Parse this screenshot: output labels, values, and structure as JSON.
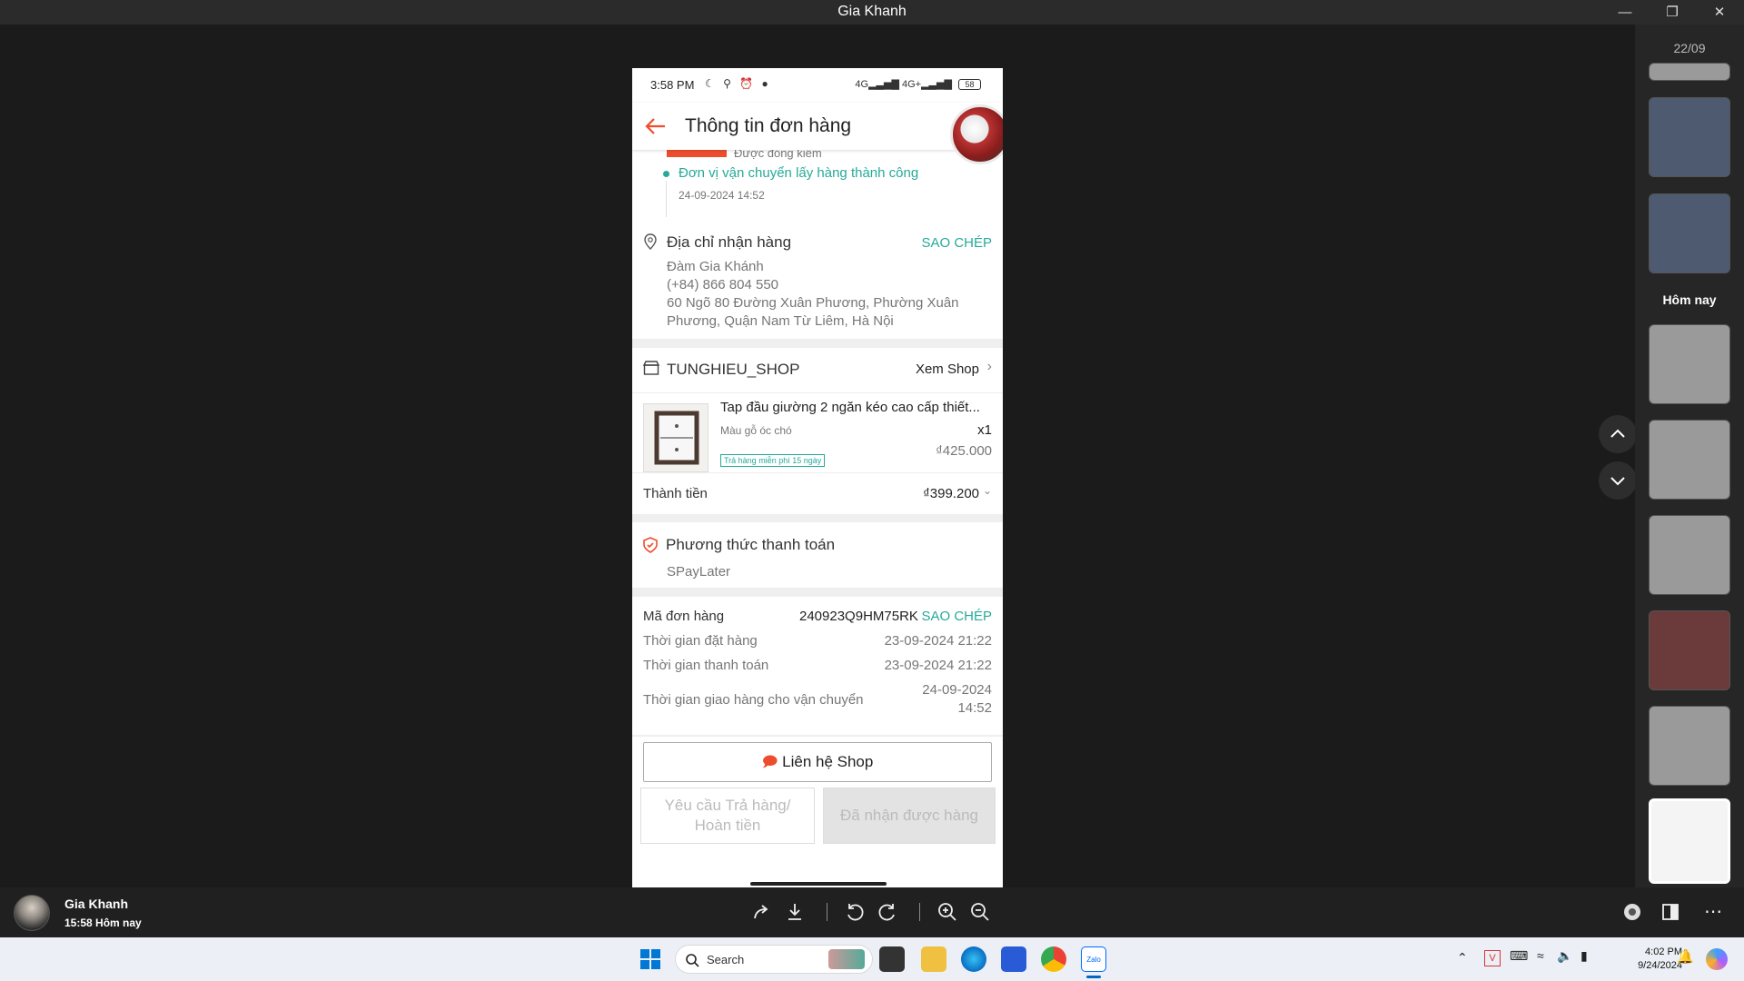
{
  "window": {
    "title": "Gia Khanh"
  },
  "phone": {
    "status": {
      "time": "3:58 PM",
      "network": "4G",
      "network2": "4G+",
      "battery": "58"
    },
    "appbar": {
      "title": "Thông tin đơn hàng"
    },
    "tracking": {
      "partial_text": "Được đóng kiểm",
      "event": "Đơn vị vận chuyển lấy hàng thành công",
      "event_time": "24-09-2024 14:52"
    },
    "address": {
      "heading": "Địa chỉ nhận hàng",
      "copy": "SAO CHÉP",
      "name": "Đàm Gia Khánh",
      "phone": "(+84) 866 804 550",
      "line1": "60 Ngõ 80 Đường Xuân Phương, Phường Xuân",
      "line2": "Phương, Quận Nam Từ Liêm, Hà Nội"
    },
    "shop": {
      "name": "TUNGHIEU_SHOP",
      "view": "Xem Shop",
      "product_title": "Tap đầu giường 2 ngăn kéo cao cấp thiết...",
      "variant": "Màu gỗ óc chó",
      "qty": "x1",
      "tag": "Trả hàng miễn phí 15 ngày",
      "price": "₫425.000",
      "total_label": "Thành tiền",
      "total": "₫399.200"
    },
    "payment": {
      "heading": "Phương thức thanh toán",
      "method": "SPayLater"
    },
    "order": {
      "id_label": "Mã đơn hàng",
      "id": "240923Q9HM75RK",
      "copy": "SAO CHÉP",
      "placed_label": "Thời gian đặt hàng",
      "placed": "23-09-2024 21:22",
      "paid_label": "Thời gian thanh toán",
      "paid": "23-09-2024 21:22",
      "ship_label": "Thời gian giao hàng cho vận chuyển",
      "ship_date": "24-09-2024",
      "ship_time": "14:52"
    },
    "actions": {
      "contact": "Liên hệ Shop",
      "return_1": "Yêu cầu Trả hàng/",
      "return_2": "Hoàn tiền",
      "received": "Đã nhận được hàng"
    }
  },
  "strip": {
    "date": "22/09",
    "today": "Hôm nay"
  },
  "bottom": {
    "user": "Gia Khanh",
    "time": "15:58 Hôm nay"
  },
  "taskbar": {
    "search": "Search",
    "time": "4:02 PM",
    "date": "9/24/2024"
  },
  "colors": {
    "accent": "#26aa99",
    "brand": "#ee4d2d"
  }
}
